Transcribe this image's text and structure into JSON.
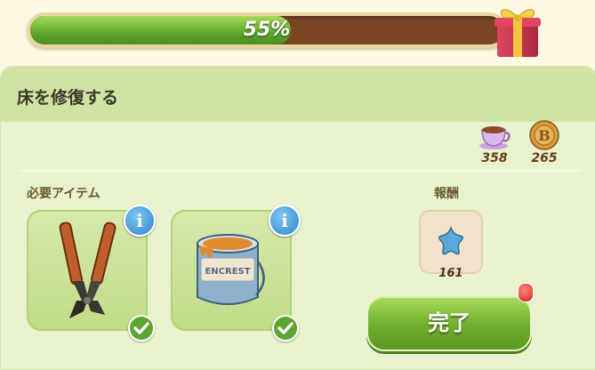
{
  "progress": {
    "percent": 55,
    "label": "55%"
  },
  "task": {
    "title": "床を修復する"
  },
  "resources": [
    {
      "icon": "tea-cup-icon",
      "count": "358"
    },
    {
      "icon": "bronze-coin-icon",
      "count": "265"
    }
  ],
  "required": {
    "label": "必要アイテム",
    "items": [
      {
        "icon": "bolt-cutter-icon",
        "info": "i",
        "completed": true
      },
      {
        "icon": "paint-can-icon",
        "info": "i",
        "completed": true,
        "can_text": "ENCREST"
      }
    ]
  },
  "reward": {
    "label": "報酬",
    "icon": "blue-star-icon",
    "count": "161"
  },
  "complete_button": {
    "label": "完了"
  },
  "colors": {
    "accent_green": "#6fae2d",
    "progress_track": "#7a4522",
    "info_blue": "#2e86cc"
  }
}
